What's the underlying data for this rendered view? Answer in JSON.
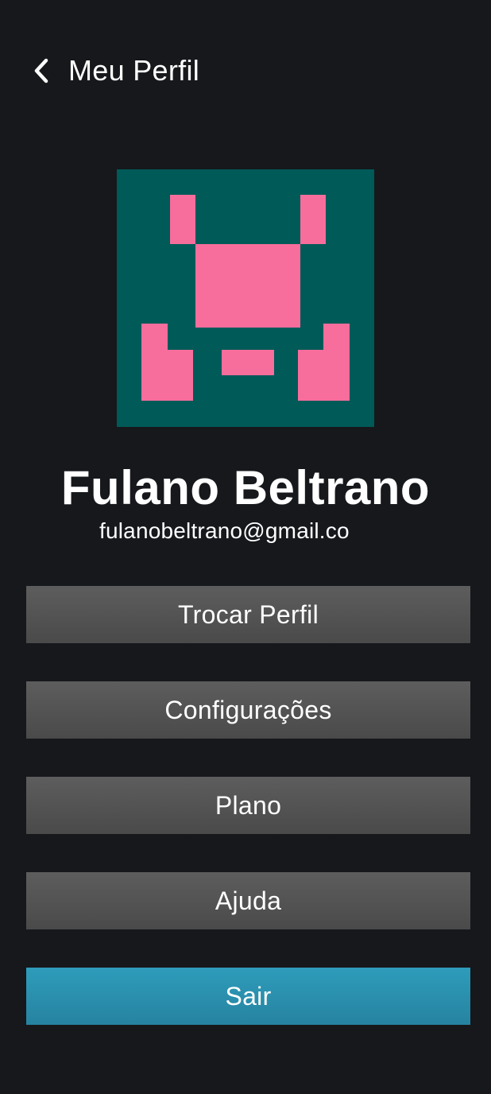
{
  "header": {
    "title": "Meu Perfil",
    "back_icon": "chevron-left-icon"
  },
  "profile": {
    "avatar_colors": {
      "background": "#005a58",
      "foreground": "#f76d9c"
    },
    "name": "Fulano Beltrano",
    "email": "fulanobeltrano@gmail.co"
  },
  "menu": {
    "trocar_perfil": "Trocar Perfil",
    "configuracoes": "Configurações",
    "plano": "Plano",
    "ajuda": "Ajuda",
    "sair": "Sair"
  },
  "colors": {
    "background": "#16181c",
    "button": "#545454",
    "accent": "#2a90ae"
  }
}
